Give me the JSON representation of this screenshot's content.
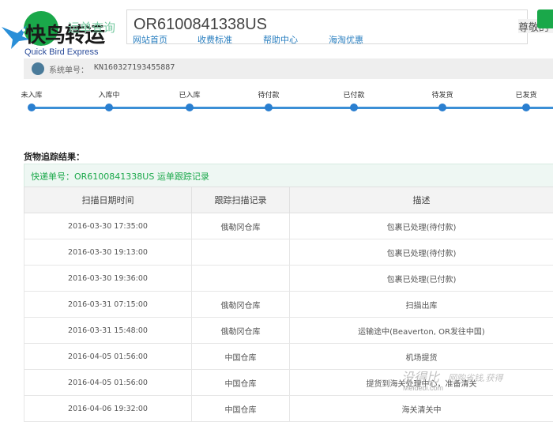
{
  "header": {
    "logo_text": "快鸟转运",
    "logo_sub": "Quick Bird Express",
    "nav_faded": "运单查询",
    "search_value": "OR6100841338US",
    "nav_links": [
      "网站首页",
      "收费标准",
      "帮助中心",
      "海淘优惠"
    ],
    "greeting": "尊敬的"
  },
  "system": {
    "label": "系统单号：",
    "value": "KN160327193455887"
  },
  "progress": {
    "steps": [
      "未入库",
      "入库中",
      "已入库",
      "待付款",
      "已付款",
      "待发货",
      "已发货"
    ]
  },
  "results": {
    "title": "货物追踪结果：",
    "tracking_header": "快递单号：OR6100841338US 运单跟踪记录"
  },
  "table": {
    "headers": [
      "扫描日期时间",
      "跟踪扫描记录",
      "描述"
    ],
    "rows": [
      [
        "2016-03-30 17:35:00",
        "俄勒冈仓库",
        "包裹已处理(待付款)"
      ],
      [
        "2016-03-30 19:13:00",
        "",
        "包裹已处理(待付款)"
      ],
      [
        "2016-03-30 19:36:00",
        "",
        "包裹已处理(已付款)"
      ],
      [
        "2016-03-31 07:15:00",
        "俄勒冈仓库",
        "扫描出库"
      ],
      [
        "2016-03-31 15:48:00",
        "俄勒冈仓库",
        "运输途中(Beaverton, OR发往中国)"
      ],
      [
        "2016-04-05 01:56:00",
        "中国仓库",
        "机场提货"
      ],
      [
        "2016-04-05 01:56:00",
        "中国仓库",
        "提货到海关处理中心，准备清关"
      ],
      [
        "2016-04-06 19:32:00",
        "中国仓库",
        "海关清关中"
      ]
    ]
  },
  "watermark": {
    "main": "没得比",
    "sub": "Meidebi.com",
    "slogan": "网购省钱,获得"
  },
  "colors": {
    "brand_green": "#1aa84a",
    "progress_blue": "#3b8fd6",
    "link_blue": "#2a7fc0"
  }
}
